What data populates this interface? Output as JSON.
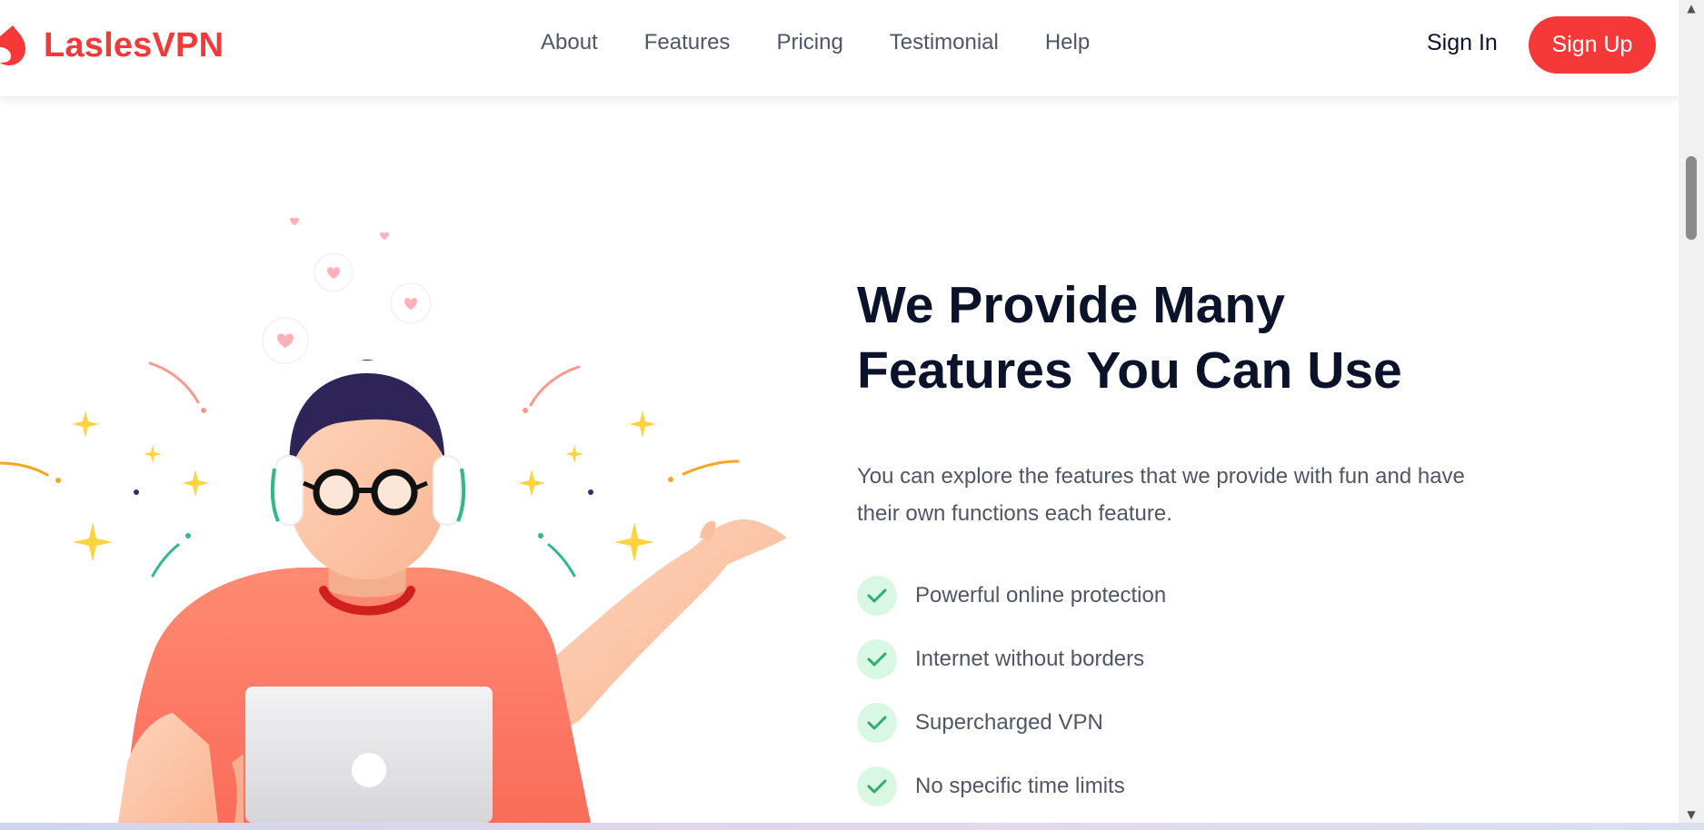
{
  "brand": {
    "name": "LaslesVPN",
    "color": "#f53838"
  },
  "nav": {
    "links": [
      {
        "label": "About"
      },
      {
        "label": "Features"
      },
      {
        "label": "Pricing"
      },
      {
        "label": "Testimonial"
      },
      {
        "label": "Help"
      }
    ],
    "sign_in": "Sign In",
    "sign_up": "Sign Up"
  },
  "hero": {
    "heading": "We Provide Many Features You Can Use",
    "description": "You can explore the features that we provide with fun and have their own functions each feature.",
    "features": [
      {
        "label": "Powerful online protection"
      },
      {
        "label": "Internet without borders"
      },
      {
        "label": "Supercharged VPN"
      },
      {
        "label": "No specific time limits"
      }
    ]
  },
  "icons": {
    "logo": "logo-icon",
    "check": "check-icon",
    "scroll_up": "scroll-up-arrow-icon",
    "scroll_down": "scroll-down-arrow-icon"
  },
  "colors": {
    "accent": "#f53838",
    "heading": "#0b132a",
    "body_text": "#4f5665",
    "check_bg": "#d8f8e3",
    "check_mark": "#2fab73"
  }
}
